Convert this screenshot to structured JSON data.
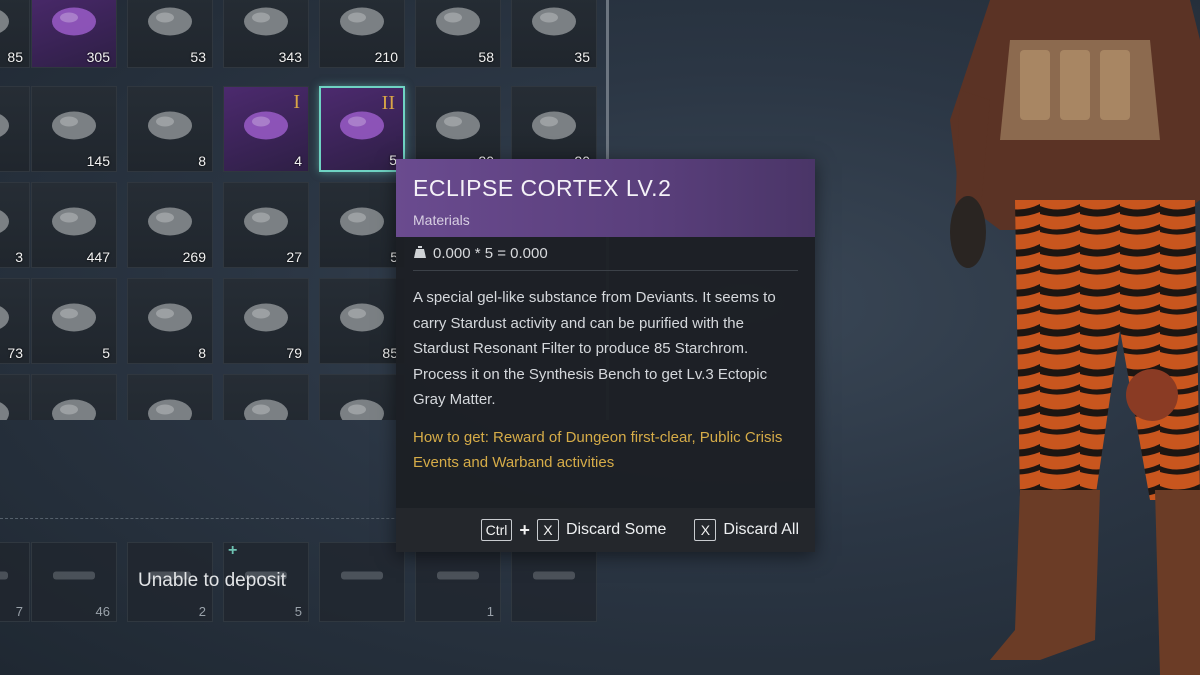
{
  "inventory": {
    "rows": [
      [
        {
          "qty": "85",
          "tier": "",
          "icon": "partial-item-icon",
          "style": "normal"
        },
        {
          "qty": "305",
          "tier": "",
          "icon": "purple-orb-icon",
          "style": "purple"
        },
        {
          "qty": "53",
          "tier": "",
          "icon": "ore-pile-icon",
          "style": "normal"
        },
        {
          "qty": "343",
          "tier": "",
          "icon": "bottle-icon",
          "style": "normal"
        },
        {
          "qty": "210",
          "tier": "",
          "icon": "yellow-lump-icon",
          "style": "normal"
        },
        {
          "qty": "58",
          "tier": "",
          "icon": "circuit-board-icon",
          "style": "normal"
        },
        {
          "qty": "35",
          "tier": "",
          "icon": "glass-tube-icon",
          "style": "normal"
        }
      ],
      [
        {
          "qty": "",
          "tier": "",
          "icon": "partial-item-icon",
          "style": "normal"
        },
        {
          "qty": "145",
          "tier": "",
          "icon": "wood-log-icon",
          "style": "normal"
        },
        {
          "qty": "8",
          "tier": "",
          "icon": "leather-hide-icon",
          "style": "normal"
        },
        {
          "qty": "4",
          "tier": "I",
          "icon": "purple-crystal-icon",
          "style": "purple"
        },
        {
          "qty": "5",
          "tier": "II",
          "icon": "eclipse-cortex-icon",
          "style": "purple-selected"
        },
        {
          "qty": "20",
          "tier": "",
          "icon": "metal-plate-icon",
          "style": "normal"
        },
        {
          "qty": "20",
          "tier": "",
          "icon": "metal-rod-icon",
          "style": "normal"
        }
      ],
      [
        {
          "qty": "3",
          "tier": "",
          "icon": "partial-item-icon",
          "style": "normal"
        },
        {
          "qty": "447",
          "tier": "",
          "icon": "tube-icon",
          "style": "normal"
        },
        {
          "qty": "269",
          "tier": "",
          "icon": "cloth-roll-icon",
          "style": "normal"
        },
        {
          "qty": "27",
          "tier": "",
          "icon": "seed-pile-icon",
          "style": "normal"
        },
        {
          "qty": "5",
          "tier": "",
          "icon": "fabric-scrap-icon",
          "style": "normal"
        },
        {
          "qty": "",
          "tier": "",
          "icon": "",
          "style": "hidden"
        },
        {
          "qty": "",
          "tier": "",
          "icon": "",
          "style": "hidden"
        }
      ],
      [
        {
          "qty": "73",
          "tier": "",
          "icon": "partial-item-icon",
          "style": "normal"
        },
        {
          "qty": "5",
          "tier": "",
          "icon": "fabric-roll-icon",
          "style": "normal"
        },
        {
          "qty": "8",
          "tier": "",
          "icon": "gold-spool-icon",
          "style": "normal"
        },
        {
          "qty": "79",
          "tier": "",
          "icon": "bolts-icon",
          "style": "normal"
        },
        {
          "qty": "85",
          "tier": "",
          "icon": "scrap-pile-icon",
          "style": "normal"
        },
        {
          "qty": "",
          "tier": "",
          "icon": "",
          "style": "hidden"
        },
        {
          "qty": "",
          "tier": "",
          "icon": "",
          "style": "hidden"
        }
      ],
      [
        {
          "qty": "",
          "tier": "",
          "icon": "partial-item-icon",
          "style": "normal"
        },
        {
          "qty": "",
          "tier": "",
          "icon": "clamp-icon",
          "style": "normal"
        },
        {
          "qty": "",
          "tier": "",
          "icon": "bracket-icon",
          "style": "normal"
        },
        {
          "qty": "",
          "tier": "",
          "icon": "hinge-icon",
          "style": "normal"
        },
        {
          "qty": "",
          "tier": "",
          "icon": "claw-icon",
          "style": "normal"
        },
        {
          "qty": "",
          "tier": "",
          "icon": "",
          "style": "hidden"
        },
        {
          "qty": "",
          "tier": "",
          "icon": "",
          "style": "hidden"
        }
      ]
    ]
  },
  "deposit": {
    "label": "Unable to deposit",
    "plus": "+",
    "slots": [
      {
        "qty": "7",
        "icon": "partial-item-icon"
      },
      {
        "qty": "46",
        "icon": "mug-icon"
      },
      {
        "qty": "2",
        "icon": "blank-slot-icon"
      },
      {
        "qty": "5",
        "icon": "rifle-icon"
      },
      {
        "qty": "",
        "icon": "axe-icon"
      },
      {
        "qty": "1",
        "icon": "shotgun-icon"
      },
      {
        "qty": "",
        "icon": "rifle-icon"
      }
    ]
  },
  "tooltip": {
    "title": "ECLIPSE CORTEX LV.2",
    "category": "Materials",
    "weight": "0.000 * 5 = 0.000",
    "description": "A special gel-like substance from Deviants. It seems to carry Stardust activity and can be purified with the Stardust Resonant Filter to produce 85 Starchrom. Process it on the Synthesis Bench to get Lv.3 Ectopic Gray Matter.",
    "how_to_get": "How to get: Reward of Dungeon first-clear, Public Crisis Events and Warband activities",
    "actions": {
      "ctrl_key": "Ctrl",
      "plus": "+",
      "discard_some_key": "X",
      "discard_some_label": "Discard Some",
      "discard_all_key": "X",
      "discard_all_label": "Discard All"
    }
  },
  "colors": {
    "tooltip_header": "#6a4b8f",
    "how_to_get": "#d6ac48",
    "selection": "#6fd3c3",
    "tier_numeral": "#d9a546"
  }
}
